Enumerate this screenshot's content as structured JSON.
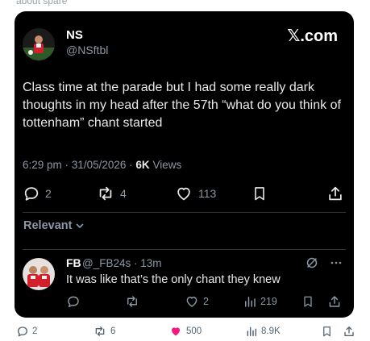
{
  "top_cut_text": "about spare",
  "tweet": {
    "author_name": "NS",
    "author_handle": "@NSftbl",
    "brand": "𝕏.com",
    "text": "Class time at the parade but I had some really dark thoughts in my head after the 57th “what do you think of tottenham” chant started",
    "time": "6:29 pm",
    "date": "31/05/2026",
    "views_count": "6K",
    "views_label": "Views",
    "separator": "·",
    "replies": "2",
    "reposts": "4",
    "likes": "113",
    "filter_label": "Relevant"
  },
  "reply": {
    "name": "FB",
    "handle": "@_FB24s",
    "time": "13m",
    "separator": "·",
    "text": "It was like that’s the only chant they knew",
    "replies": "",
    "reposts": "",
    "likes": "2",
    "views": "219"
  },
  "outer": {
    "replies": "2",
    "reposts": "6",
    "likes": "500",
    "views": "8.9K"
  },
  "colors": {
    "card_bg": "#000000",
    "text_primary": "#e7e9ea",
    "text_secondary": "#8b98a5",
    "like_pink": "#f91880",
    "outer_icon": "#536471"
  }
}
